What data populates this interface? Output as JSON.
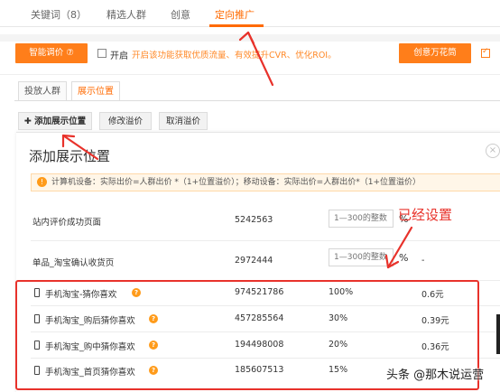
{
  "tabs": [
    {
      "label": "关键词（8）"
    },
    {
      "label": "精选人群"
    },
    {
      "label": "创意"
    },
    {
      "label": "定向推广"
    }
  ],
  "toolbar": {
    "smart_bid_label": "智能调价 ⑦",
    "enable_label": "开启",
    "enable_hint": "开启该功能获取优质流量、有效提升CVR、优化ROI。",
    "creative_label": "创意万花筒"
  },
  "subtabs": [
    {
      "label": "投放人群"
    },
    {
      "label": "展示位置"
    }
  ],
  "actions": {
    "add_label": "✚ 添加展示位置",
    "modify_label": "修改溢价",
    "cancel_label": "取消溢价"
  },
  "dialog": {
    "title": "添加展示位置",
    "close_glyph": "×",
    "notice": "计算机设备：实际出价=人群出价 *（1+位置溢价）；移动设备：实际出价=人群出价*（1+位置溢价）",
    "input_placeholder": "1—300的整数",
    "percent": "%",
    "rows": [
      {
        "name": "站内评价成功页面",
        "value": "5242563"
      },
      {
        "name": "单品_淘宝确认收货页",
        "value": "2972444",
        "dash": "-"
      }
    ],
    "mobile_rows": [
      {
        "name": "手机淘宝-猜你喜欢",
        "value": "974521786",
        "premium": "100%",
        "price": "0.6元"
      },
      {
        "name": "手机淘宝_购后猜你喜欢",
        "value": "457285564",
        "premium": "30%",
        "price": "0.39元"
      },
      {
        "name": "手机淘宝_购中猜你喜欢",
        "value": "194498008",
        "premium": "20%",
        "price": "0.36元"
      },
      {
        "name": "手机淘宝_首页猜你喜欢",
        "value": "185607513",
        "premium": "15%",
        "price": ""
      }
    ]
  },
  "annotation": "已经设置",
  "watermark": "头条 @那木说运营",
  "colors": {
    "accent": "#ff6a00",
    "annotation": "#e8322b"
  }
}
